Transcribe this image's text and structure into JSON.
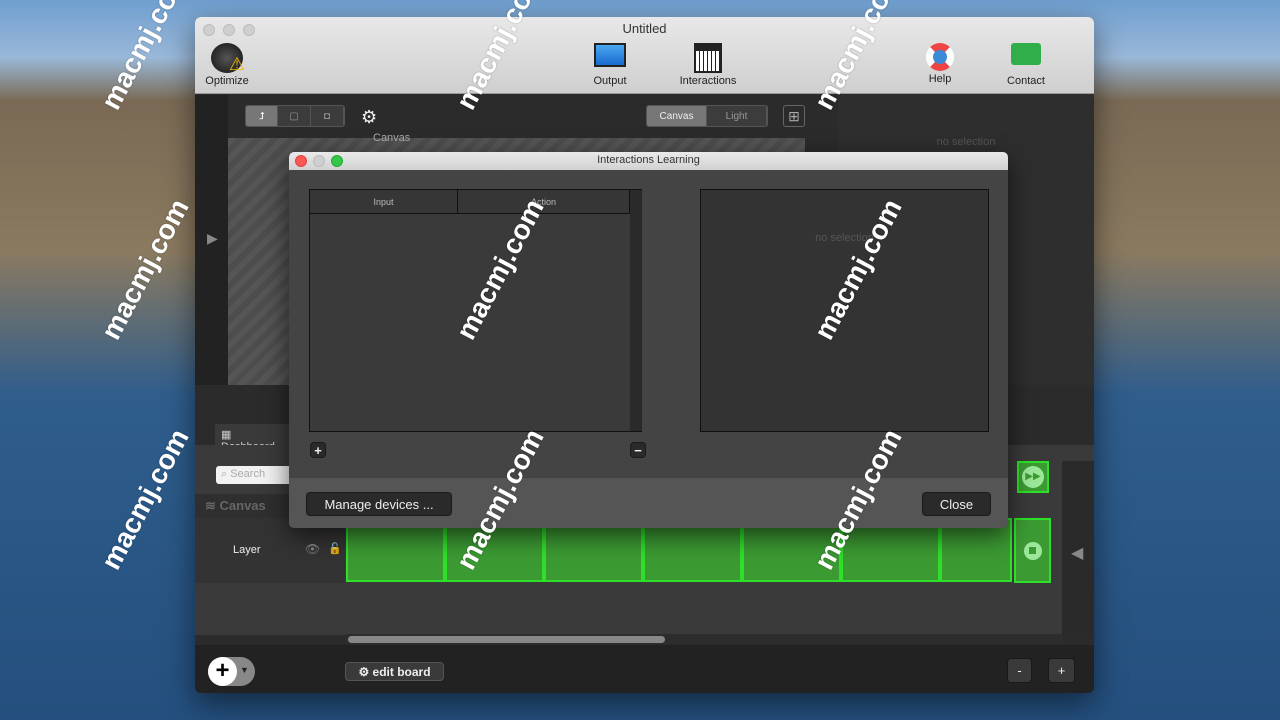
{
  "window": {
    "title": "Untitled"
  },
  "toolbar": {
    "optimize": "Optimize",
    "output": "Output",
    "interactions": "Interactions",
    "help": "Help",
    "contact": "Contact"
  },
  "canvas_toolbar": {
    "mode_canvas": "Canvas",
    "mode_light": "Light",
    "canvas_label": "Canvas"
  },
  "inspector": {
    "empty": "no selection"
  },
  "dashboard": {
    "tab": "Dashboard",
    "search_placeholder": "Search",
    "canvas_header": "Canvas",
    "layer_name": "Layer",
    "clip_count": 7
  },
  "bottom": {
    "edit_board": "edit board",
    "minus": "-",
    "plus": "+"
  },
  "dialog": {
    "title": "Interactions Learning",
    "columns": [
      "Input",
      "Action"
    ],
    "rows": [],
    "detail_empty": "no selection",
    "add": "+",
    "remove": "−",
    "manage": "Manage devices ...",
    "close": "Close"
  },
  "colors": {
    "clip_green": "#3c9a33",
    "clip_border": "#2ee02a",
    "close_red": "#fc5753",
    "zoom_green": "#33c748"
  },
  "watermarks": [
    "macmj.com"
  ]
}
